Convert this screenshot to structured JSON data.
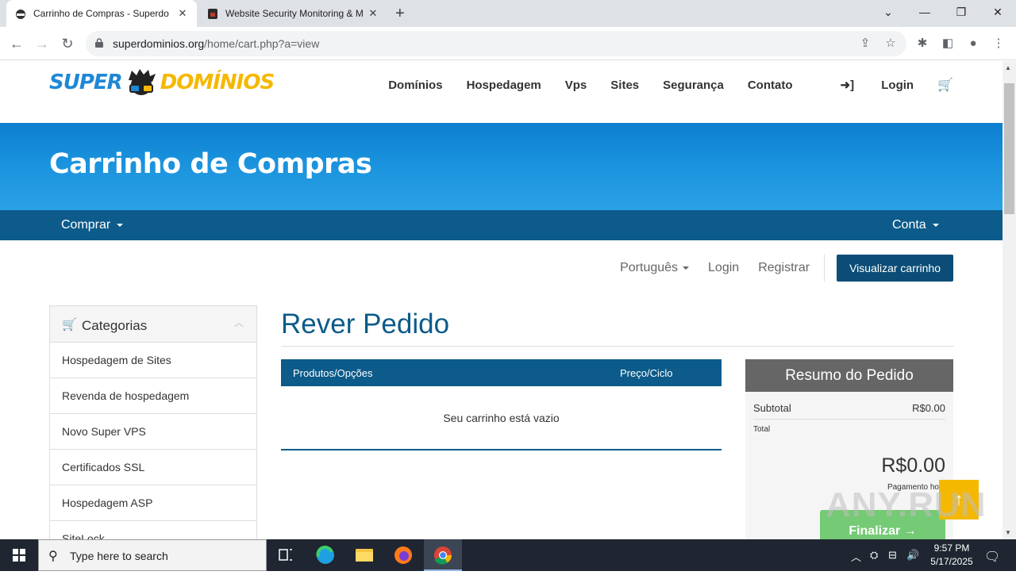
{
  "browser": {
    "tabs": [
      {
        "title": "Carrinho de Compras - Superdo"
      },
      {
        "title": "Website Security Monitoring & M"
      }
    ],
    "new_tab": "+",
    "url_host": "superdominios.org",
    "url_path": "/home/cart.php?a=view"
  },
  "site": {
    "logo": {
      "part1": "SUPER",
      "part2": "DOMÍNIOS"
    },
    "nav": [
      "Domínios",
      "Hospedagem",
      "Vps",
      "Sites",
      "Segurança",
      "Contato"
    ],
    "login": "Login",
    "page_title": "Carrinho de Compras",
    "subnav_left": "Comprar",
    "subnav_right": "Conta",
    "language": "Português",
    "login_link": "Login",
    "register_link": "Registrar",
    "view_cart": "Visualizar carrinho"
  },
  "sidebar": {
    "title": "Categorias",
    "items": [
      "Hospedagem de Sites",
      "Revenda de hospedagem",
      "Novo Super VPS",
      "Certificados SSL",
      "Hospedagem ASP",
      "SiteLock"
    ]
  },
  "main": {
    "heading": "Rever Pedido",
    "col_products": "Produtos/Opções",
    "col_price": "Preço/Ciclo",
    "empty_message": "Seu carrinho está vazio"
  },
  "summary": {
    "title": "Resumo do Pedido",
    "subtotal_label": "Subtotal",
    "subtotal_value": "R$0.00",
    "total_label": "Total",
    "total_value": "R$0.00",
    "payment_note": "Pagamento ho",
    "checkout": "Finalizar →"
  },
  "watermark": "ANY.RUN",
  "taskbar": {
    "search_placeholder": "Type here to search",
    "time": "9:57 PM",
    "date": "5/17/2025"
  },
  "colors": {
    "accent": "#0c5b8a",
    "hero": "#1a92dd",
    "logo_blue": "#1e88d6",
    "logo_yellow": "#f5b800"
  }
}
